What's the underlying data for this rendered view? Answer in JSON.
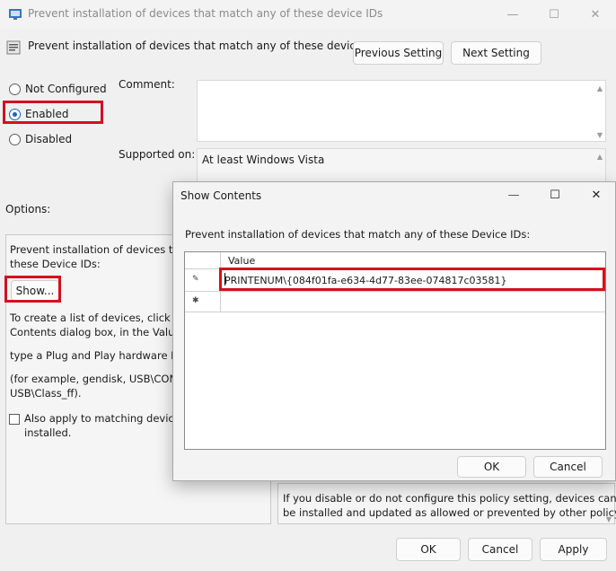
{
  "window": {
    "title": "Prevent installation of devices that match any of these device IDs",
    "controls": {
      "minimize": "—",
      "maximize": "☐",
      "close": "✕"
    }
  },
  "header": {
    "policy_name": "Prevent installation of devices that match any of these device IDs",
    "previous_label": "Previous Setting",
    "next_label": "Next Setting"
  },
  "state": {
    "options": [
      {
        "label": "Not Configured",
        "selected": false
      },
      {
        "label": "Enabled",
        "selected": true
      },
      {
        "label": "Disabled",
        "selected": false
      }
    ]
  },
  "comment": {
    "label": "Comment:",
    "value": ""
  },
  "supported": {
    "label": "Supported on:",
    "value": "At least Windows Vista"
  },
  "options_section": {
    "label": "Options:",
    "desc_line1": "Prevent installation of devices that",
    "desc_line2": "these Device IDs:",
    "show_label": "Show...",
    "para1_line1": "To create a list of devices, click Sho",
    "para1_line2": "Contents dialog box, in the Value c",
    "para2": "type a Plug and Play hardware ID o",
    "para3_line1": "(for example, gendisk, USB\\COMPO",
    "para3_line2": "USB\\Class_ff).",
    "checkbox_line1": "Also apply to matching devices",
    "checkbox_line2": "installed."
  },
  "help_section": {
    "line1": "If you disable or do not configure this policy setting, devices can",
    "line2": "be installed and updated as allowed or prevented by other policy"
  },
  "footer": {
    "ok_label": "OK",
    "cancel_label": "Cancel",
    "apply_label": "Apply"
  },
  "dialog": {
    "title": "Show Contents",
    "controls": {
      "minimize": "—",
      "maximize": "☐",
      "close": "✕"
    },
    "description": "Prevent installation of devices that match any of these Device IDs:",
    "column_header": "Value",
    "rows": [
      {
        "marker": "✎",
        "value": "PRINTENUM\\{084f01fa-e634-4d77-83ee-074817c03581}"
      },
      {
        "marker": "✱",
        "value": ""
      }
    ],
    "ok_label": "OK",
    "cancel_label": "Cancel"
  },
  "colors": {
    "highlight": "#d4101e",
    "radio_selected": "#1565c0"
  }
}
